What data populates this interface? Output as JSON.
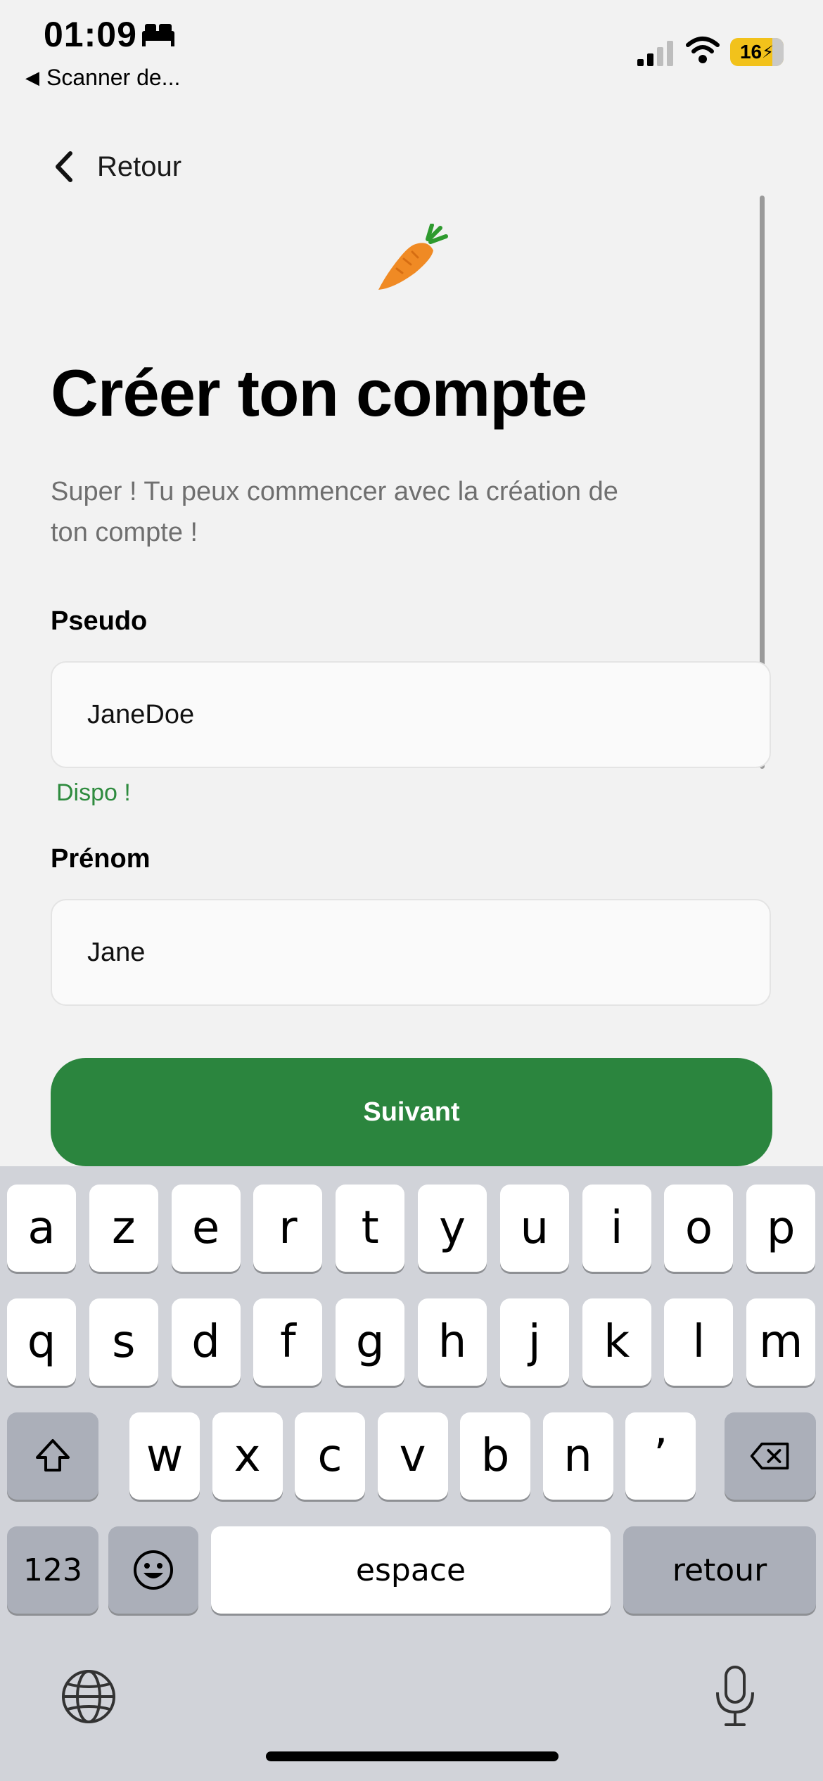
{
  "status_bar": {
    "time": "01:09",
    "back_app": "Scanner de...",
    "battery": "16"
  },
  "nav": {
    "back_label": "Retour"
  },
  "header": {
    "title": "Créer ton compte",
    "subtitle": "Super ! Tu peux commencer avec la création de ton compte !"
  },
  "form": {
    "pseudo_label": "Pseudo",
    "pseudo_value": "JaneDoe",
    "pseudo_hint": "Dispo !",
    "prenom_label": "Prénom",
    "prenom_value": "Jane",
    "next_button": "Suivant"
  },
  "keyboard": {
    "row1": [
      "a",
      "z",
      "e",
      "r",
      "t",
      "y",
      "u",
      "i",
      "o",
      "p"
    ],
    "row2": [
      "q",
      "s",
      "d",
      "f",
      "g",
      "h",
      "j",
      "k",
      "l",
      "m"
    ],
    "row3": [
      "w",
      "x",
      "c",
      "v",
      "b",
      "n",
      "’"
    ],
    "numbers_key": "123",
    "space_key": "espace",
    "return_key": "retour"
  },
  "colors": {
    "accent": "#2b853e",
    "hint": "#2e8b3e",
    "battery": "#f2c21b"
  }
}
